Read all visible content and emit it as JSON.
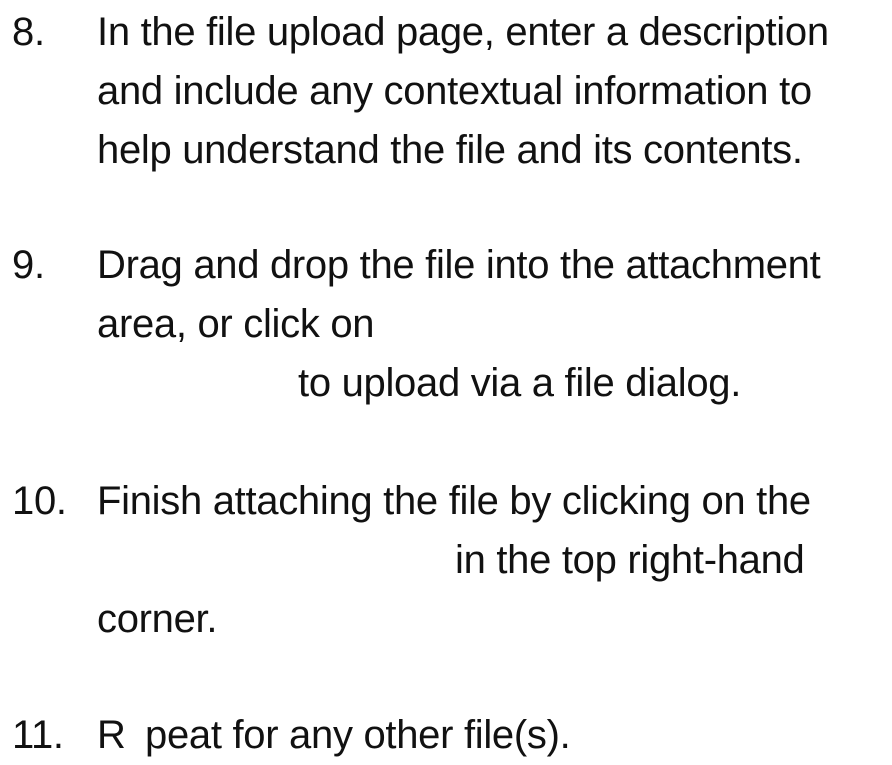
{
  "steps": [
    {
      "number": "8.",
      "lines": [
        "In the file upload page, enter a description",
        "and include any contextual information to",
        "help understand the file and its contents."
      ]
    },
    {
      "number": "9.",
      "lines": [
        "Drag and drop the file into the attachment",
        "area, or click on",
        "to upload via a file dialog."
      ]
    },
    {
      "number": "10.",
      "lines": [
        "Finish attaching the file by clicking on the",
        "in the top right-hand",
        "corner."
      ]
    },
    {
      "number": "11.",
      "lines": [
        "R",
        "peat for any other file(s)."
      ]
    }
  ]
}
